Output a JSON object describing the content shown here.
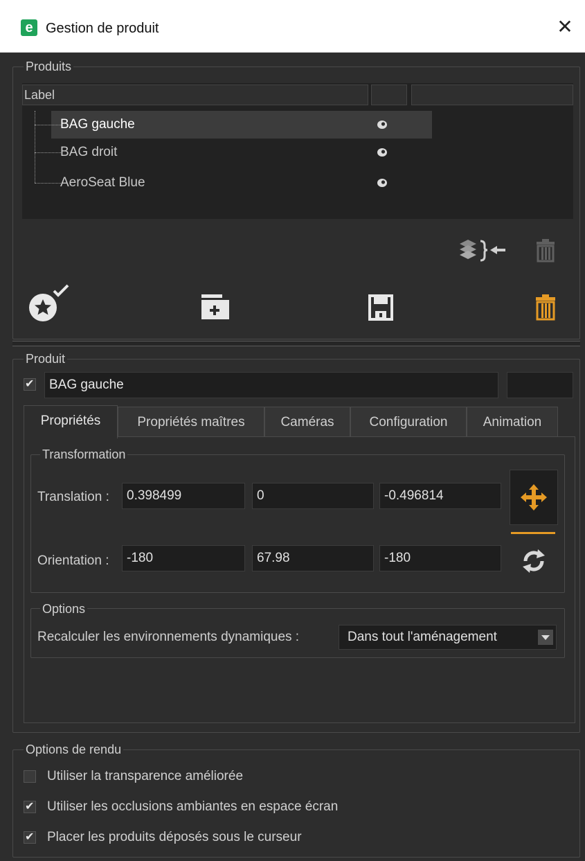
{
  "window": {
    "logo_letter": "e",
    "title": "Gestion de produit",
    "close_glyph": "✕"
  },
  "products_group": {
    "legend": "Produits",
    "columns": [
      "Label",
      "",
      ""
    ],
    "items": [
      {
        "label": "BAG gauche",
        "selected": true
      },
      {
        "label": "BAG droit",
        "selected": false
      },
      {
        "label": "AeroSeat Blue",
        "selected": false
      }
    ],
    "icons": [
      "visibility-eye-icon",
      "merge-layers-icon",
      "trash-icon",
      "star-check-icon",
      "folder-add-icon",
      "save-floppy-icon"
    ]
  },
  "product_group": {
    "legend": "Produit",
    "name_value": "BAG gauche",
    "tabs": [
      "Propriétés",
      "Propriétés maîtres",
      "Caméras",
      "Configuration",
      "Animation"
    ],
    "active_tab": "Propriétés",
    "transformation": {
      "legend": "Transformation",
      "translation_label": "Translation :",
      "translation": [
        "0.398499",
        "0",
        "-0.496814"
      ],
      "orientation_label": "Orientation :",
      "orientation": [
        "-180",
        "67.98",
        "-180"
      ]
    },
    "options": {
      "legend": "Options",
      "recalc_label": "Recalculer les environnements dynamiques :",
      "recalc_value": "Dans tout l'aménagement"
    }
  },
  "render_options": {
    "legend": "Options de rendu",
    "items": [
      {
        "label": "Utiliser la transparence améliorée",
        "checked": false
      },
      {
        "label": "Utiliser les occlusions ambiantes en espace écran",
        "checked": true
      },
      {
        "label": "Placer les produits déposés sous le curseur",
        "checked": true
      }
    ]
  },
  "colors": {
    "accent": "#e59a25",
    "background": "#2d2d2d",
    "field": "#1e1e1e"
  }
}
